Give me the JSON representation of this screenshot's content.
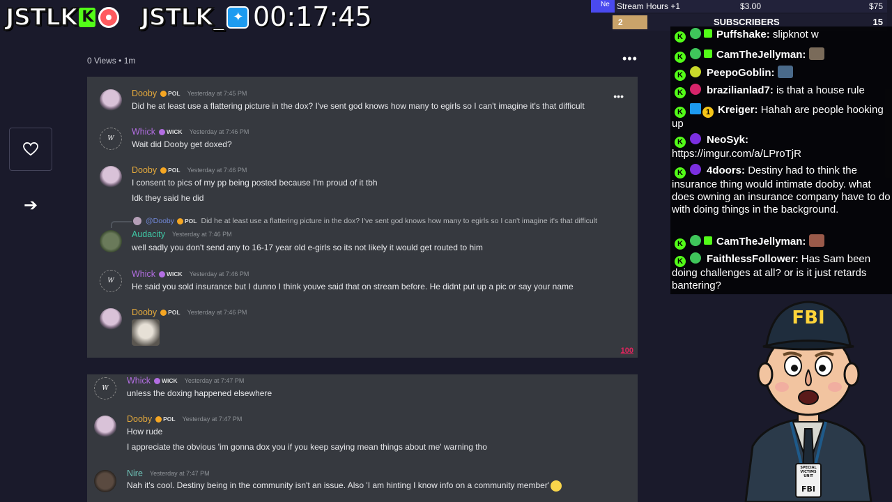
{
  "overlay": {
    "logo1": "JSTLK",
    "logo2": "JSTLK_",
    "timer": "00:17:45"
  },
  "stats": {
    "new_label": "Ne",
    "goal_label": "Stream Hours +1",
    "money": "$3.00",
    "goal": "$75",
    "sub_box": "2",
    "subscribers_label": "SUBSCRIBERS",
    "subscribers_count": "15"
  },
  "post": {
    "views": "0 Views",
    "separator": "•",
    "age": "1m"
  },
  "panel1": {
    "messages": [
      {
        "user": "Dooby",
        "tag": "POL",
        "time": "Yesterday at 7:45 PM",
        "lines": [
          "Did he at least use a flattering picture in the dox? I've sent god knows how many to egirls so I can't imagine it's that difficult"
        ]
      },
      {
        "user": "Whick",
        "tag": "WICK",
        "time": "Yesterday at 7:46 PM",
        "lines": [
          "Wait did Dooby get doxed?"
        ]
      },
      {
        "user": "Dooby",
        "tag": "POL",
        "time": "Yesterday at 7:46 PM",
        "lines": [
          "I consent to pics of my pp being posted because I'm proud of it tbh",
          "Idk they said he did"
        ]
      },
      {
        "user": "Audacity",
        "tag": "",
        "time": "Yesterday at 7:46 PM",
        "reply_mention": "@Dooby",
        "reply_tag": "POL",
        "reply_text": "Did he at least use a flattering picture in the dox? I've sent god knows how many to egirls so I can't imagine it's that difficult",
        "lines": [
          "well sadly you don't send any to 16-17 year old e-girls so its not likely it would get routed to him"
        ]
      },
      {
        "user": "Whick",
        "tag": "WICK",
        "time": "Yesterday at 7:46 PM",
        "lines": [
          "He said you sold insurance but I dunno I think youve said that on stream before. He didnt put up a pic or say your name"
        ]
      },
      {
        "user": "Dooby",
        "tag": "POL",
        "time": "Yesterday at 7:46 PM",
        "lines": []
      }
    ],
    "hundred": "100"
  },
  "panel2": {
    "messages": [
      {
        "user": "Whick",
        "tag": "WICK",
        "time": "Yesterday at 7:47 PM",
        "lines": [
          "unless the doxing happened elsewhere"
        ]
      },
      {
        "user": "Dooby",
        "tag": "POL",
        "time": "Yesterday at 7:47 PM",
        "lines": [
          "How rude",
          "I appreciate the obvious 'im gonna dox you if you keep saying mean things about me' warning tho"
        ]
      },
      {
        "user": "Nire",
        "tag": "",
        "time": "Yesterday at 7:47 PM",
        "lines": [
          "Nah it's cool. Destiny being in the community isn't an issue. Also 'I am hinting I know info on a community member'"
        ]
      }
    ]
  },
  "chat": [
    {
      "user": "Puffshake",
      "text": "slipknot w"
    },
    {
      "user": "CamTheJellyman",
      "text": ""
    },
    {
      "user": "PeepoGoblin",
      "text": ""
    },
    {
      "user": "brazilianlad7",
      "text": "is that a house rule"
    },
    {
      "user": "Kreiger",
      "text": "Hahah are people hooking up"
    },
    {
      "user": "NeoSyk",
      "text": "https://imgur.com/a/LProTjR"
    },
    {
      "user": "4doors",
      "text": "Destiny had to think the insurance thing would intimate dooby. what does owning an insurance company have to do with doing things in the background."
    },
    {
      "user": "CamTheJellyman",
      "text": ""
    },
    {
      "user": "FaithlessFollower",
      "text": "Has Sam been doing challenges at all? or is it just retards bantering?"
    }
  ],
  "chat_colon": ":",
  "cartoon": {
    "hat_text": "FBI",
    "badge_text": "FBI",
    "badge_caption": "SPECIAL VICTIMS UNIT"
  },
  "colors": {
    "background": "#1a1a2b",
    "panel": "#36393f",
    "dooby": "#e3a93d",
    "whick": "#b36ee3",
    "audacity": "#3fc7a5",
    "kick_green": "#53fc18"
  }
}
